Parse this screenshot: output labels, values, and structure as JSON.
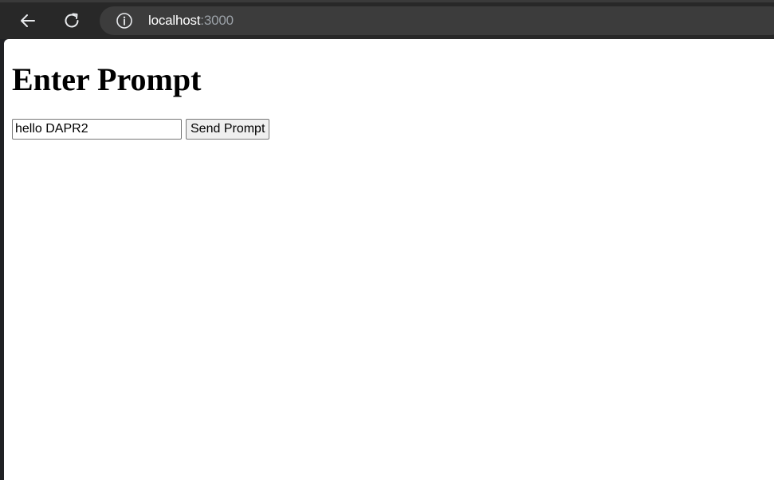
{
  "browser": {
    "url_host": "localhost",
    "url_port": ":3000",
    "icons": {
      "back": "arrow-left-icon",
      "reload": "reload-icon",
      "site_info": "info-icon"
    }
  },
  "page": {
    "title": "Enter Prompt",
    "prompt_input": {
      "value": "hello DAPR2",
      "placeholder": ""
    },
    "send_button_label": "Send Prompt"
  },
  "colors": {
    "toolbar_bg": "#282828",
    "omnibox_bg": "#3c3c3c",
    "page_bg": "#ffffff",
    "button_bg": "#efefef"
  }
}
